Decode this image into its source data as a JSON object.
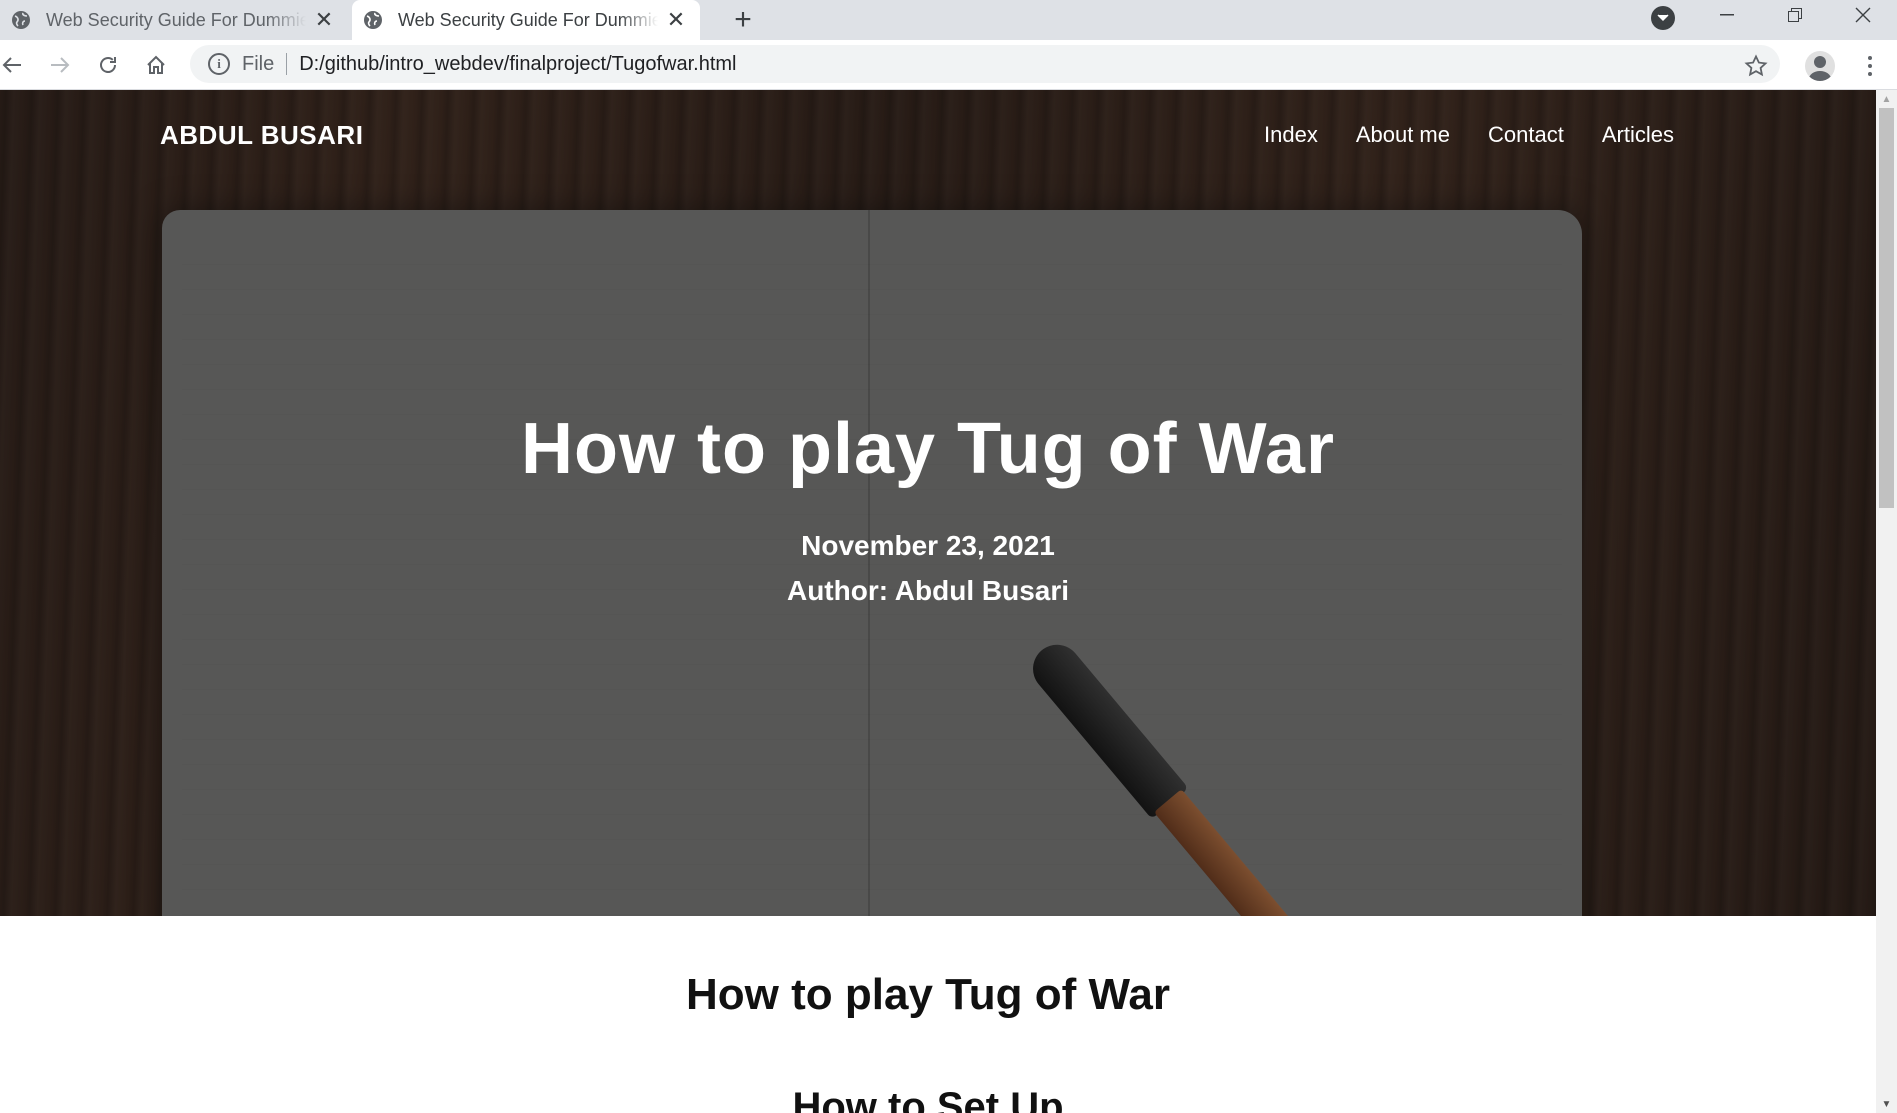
{
  "browser": {
    "tabs": [
      {
        "title": "Web Security Guide For Dummies",
        "active": false
      },
      {
        "title": "Web Security Guide For Dummies",
        "active": true
      }
    ],
    "omnibox": {
      "scheme_label": "File",
      "url": "D:/github/intro_webdev/finalproject/Tugofwar.html"
    }
  },
  "site": {
    "brand": "ABDUL BUSARI",
    "nav": [
      "Index",
      "About me",
      "Contact",
      "Articles"
    ]
  },
  "hero": {
    "heading": "How to play Tug of War",
    "date": "November 23, 2021",
    "author": "Author: Abdul Busari"
  },
  "article": {
    "title": "How to play Tug of War",
    "subtitle": "How to Set Up"
  }
}
